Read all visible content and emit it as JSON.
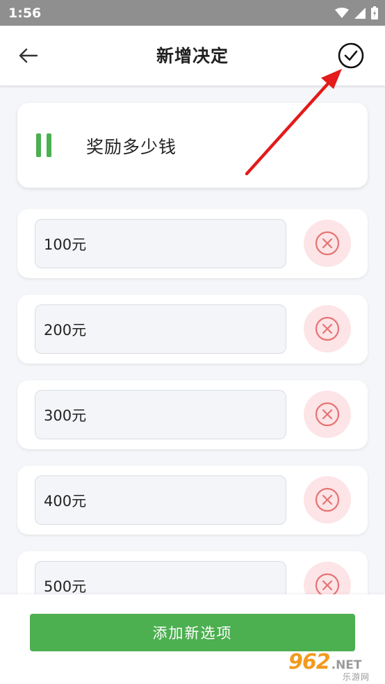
{
  "status_bar": {
    "time": "1:56"
  },
  "header": {
    "title": "新增决定"
  },
  "decision": {
    "title": "奖励多少钱"
  },
  "options": [
    {
      "value": "100元"
    },
    {
      "value": "200元"
    },
    {
      "value": "300元"
    },
    {
      "value": "400元"
    },
    {
      "value": "500元"
    }
  ],
  "footer": {
    "add_option_label": "添加新选项"
  },
  "watermark": {
    "brand": "962",
    "suffix": ".NET",
    "sub": "乐游网"
  },
  "colors": {
    "accent_green": "#4caf50",
    "remove_bg": "#fde4e6",
    "remove_icon": "#e57373",
    "annotation_red": "#e31b1b"
  },
  "icons": {
    "back": "arrow-left-icon",
    "confirm": "check-circle-icon",
    "remove": "close-circle-icon",
    "drag": "drag-handle-icon"
  }
}
